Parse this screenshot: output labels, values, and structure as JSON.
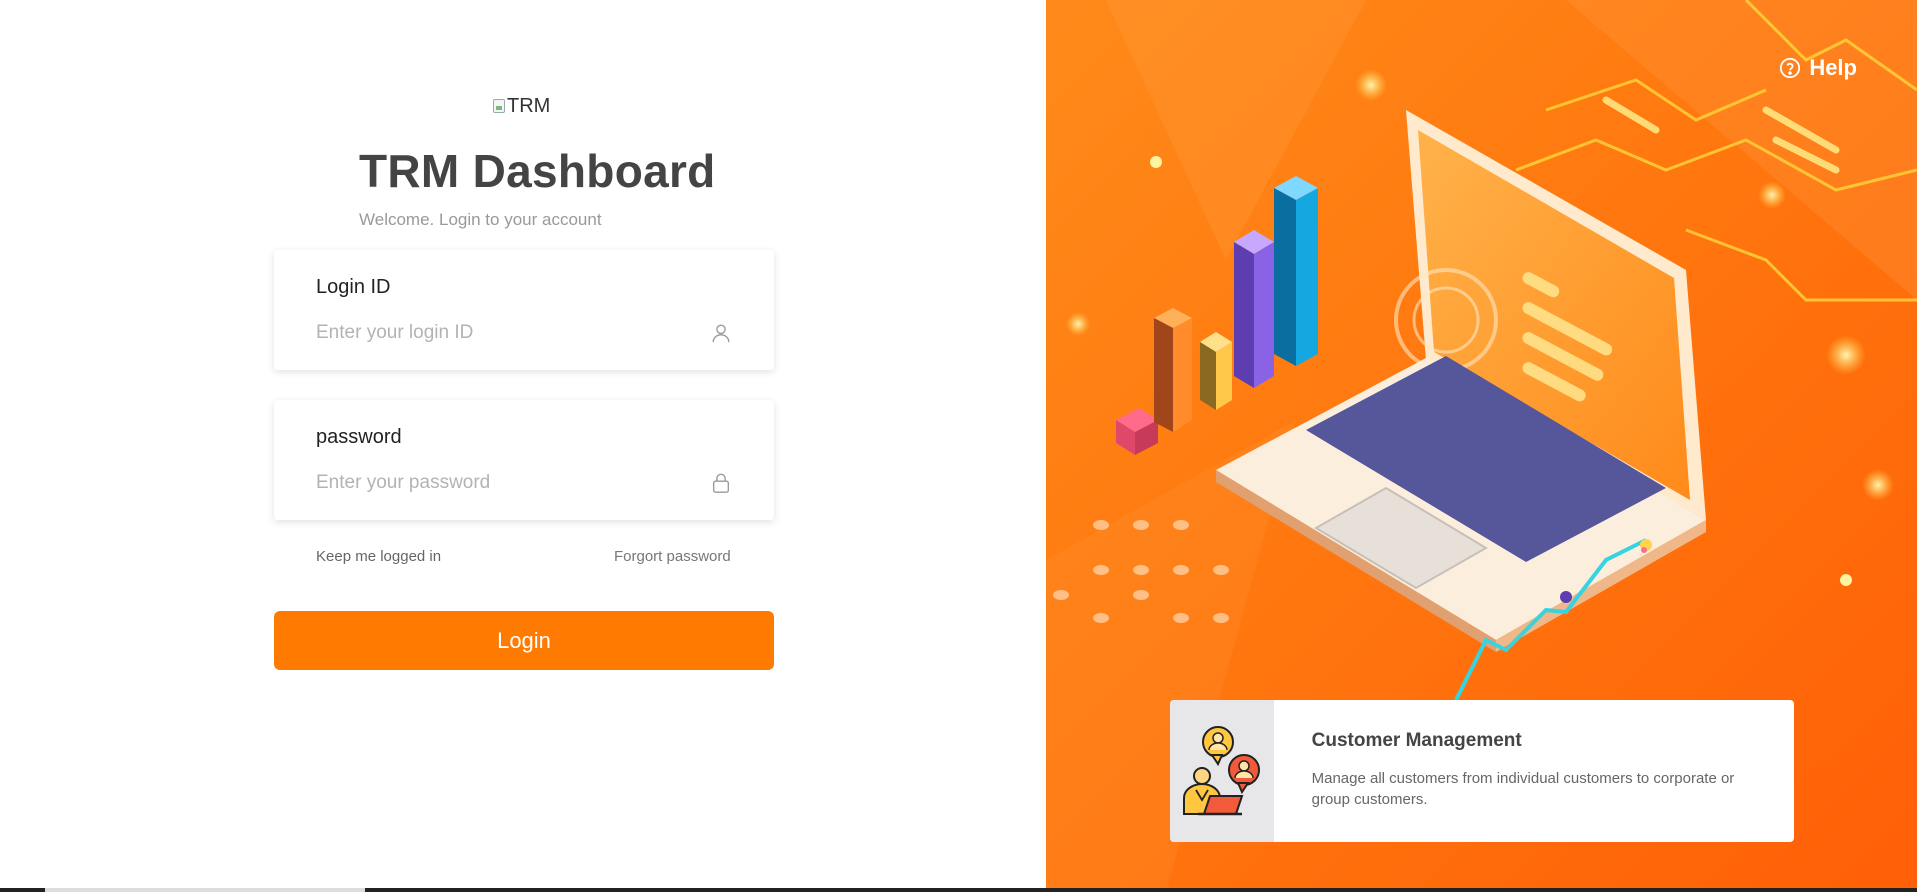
{
  "brand": {
    "logo_alt": "TRM"
  },
  "header": {
    "title": "TRM Dashboard",
    "subtitle": "Welcome. Login to your account"
  },
  "form": {
    "login_id": {
      "label": "Login ID",
      "placeholder": "Enter your login ID",
      "icon": "user-icon"
    },
    "password": {
      "label": "password",
      "placeholder": "Enter your password",
      "icon": "lock-icon"
    },
    "keep_logged_in": "Keep me logged in",
    "forgot_password": "Forgort password",
    "login_button": "Login"
  },
  "help": {
    "label": "Help",
    "icon": "help-circle-icon"
  },
  "feature": {
    "title": "Customer Management",
    "description": "Manage all customers from individual customers to corporate or group customers.",
    "icon": "customers-icon"
  },
  "colors": {
    "accent": "#ff7a00",
    "panel": "#ff7a10"
  }
}
